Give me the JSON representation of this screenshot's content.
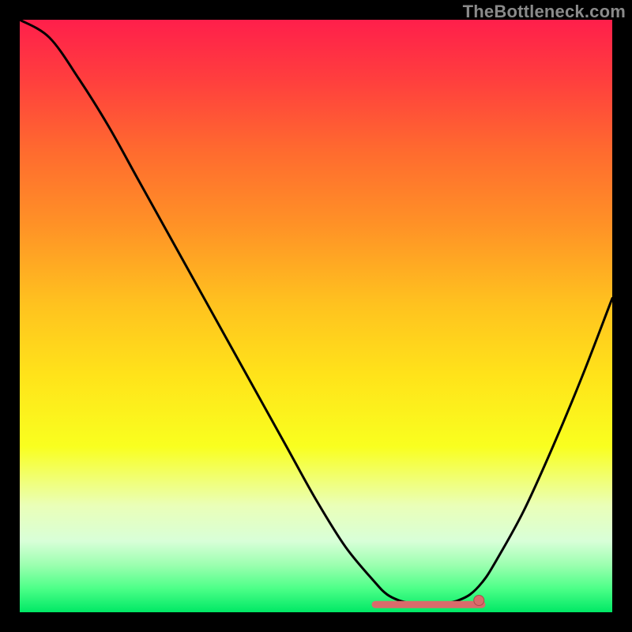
{
  "watermark": "TheBottleneck.com",
  "colors": {
    "frame": "#000000",
    "curve": "#000000",
    "marker_fill": "#d96b6b",
    "marker_stroke": "#aa4b4b",
    "gradient_stops": [
      {
        "offset": 0.0,
        "color": "#ff1f4b"
      },
      {
        "offset": 0.1,
        "color": "#ff3e3e"
      },
      {
        "offset": 0.22,
        "color": "#ff6a2f"
      },
      {
        "offset": 0.35,
        "color": "#ff9326"
      },
      {
        "offset": 0.48,
        "color": "#ffc21f"
      },
      {
        "offset": 0.6,
        "color": "#ffe31a"
      },
      {
        "offset": 0.72,
        "color": "#f9ff1f"
      },
      {
        "offset": 0.82,
        "color": "#eaffb8"
      },
      {
        "offset": 0.88,
        "color": "#d8ffd8"
      },
      {
        "offset": 0.92,
        "color": "#9cffb0"
      },
      {
        "offset": 0.96,
        "color": "#4cff88"
      },
      {
        "offset": 1.0,
        "color": "#00e865"
      }
    ]
  },
  "chart_data": {
    "type": "line",
    "title": "",
    "xlabel": "",
    "ylabel": "",
    "xlim": [
      0,
      100
    ],
    "ylim": [
      0,
      100
    ],
    "grid": false,
    "series": [
      {
        "name": "curve",
        "x": [
          0,
          5,
          10,
          15,
          20,
          25,
          30,
          35,
          40,
          45,
          50,
          55,
          60,
          62,
          64,
          66,
          68,
          70,
          72,
          74,
          76,
          78,
          80,
          85,
          90,
          95,
          100
        ],
        "y": [
          100,
          97,
          90,
          82,
          73,
          64,
          55,
          46,
          37,
          28,
          19,
          11,
          5,
          3,
          2,
          1.5,
          1.2,
          1.2,
          1.5,
          2,
          3,
          5,
          8,
          17,
          28,
          40,
          53
        ]
      }
    ],
    "flat_region": {
      "x_start": 60,
      "x_end": 78,
      "y": 1.3
    },
    "marker": {
      "x": 77.5,
      "y": 2.0
    }
  }
}
